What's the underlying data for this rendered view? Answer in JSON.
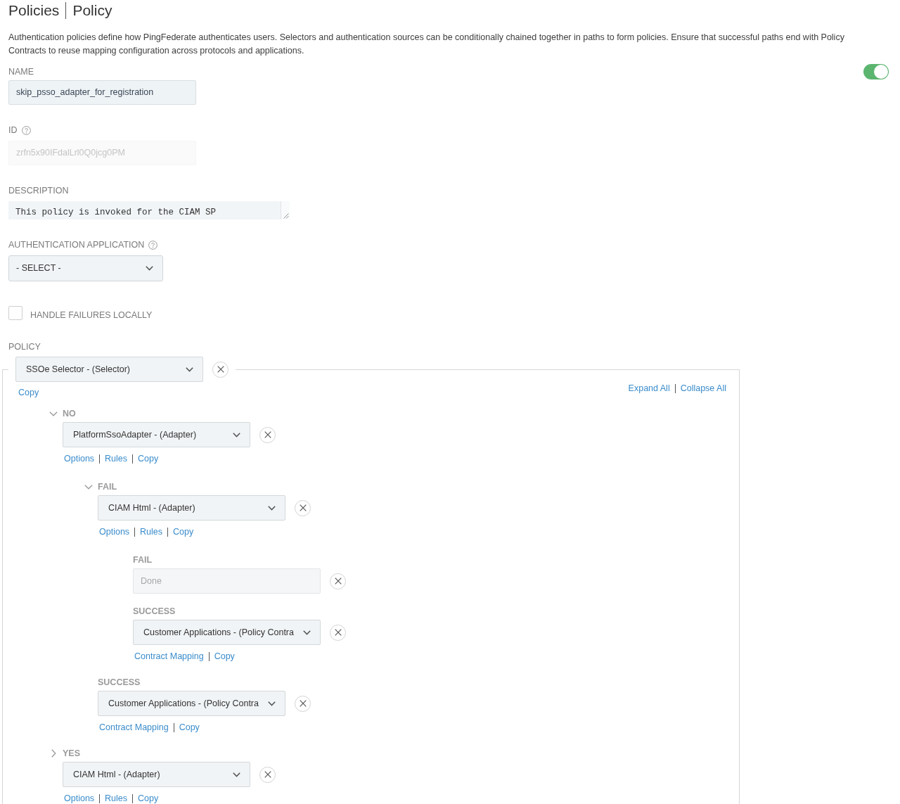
{
  "header": {
    "parent": "Policies",
    "current": "Policy"
  },
  "intro": "Authentication policies define how PingFederate authenticates users. Selectors and authentication sources can be conditionally chained together in paths to form policies. Ensure that successful paths end with Policy Contracts to reuse mapping configuration across protocols and applications.",
  "enabled_toggle": {
    "on": true
  },
  "fields": [
    {
      "kind": "text",
      "label": "NAME",
      "help": false,
      "value": "skip_psso_adapter_for_registration",
      "disabled": false
    },
    {
      "kind": "text",
      "label": "ID",
      "help": true,
      "value": "zrfn5x90IFdalLrl0Q0jcg0PM",
      "disabled": true
    },
    {
      "kind": "textarea",
      "label": "DESCRIPTION",
      "help": false,
      "value": "This policy is invoked for the CIAM SP",
      "disabled": false
    },
    {
      "kind": "select",
      "label": "AUTHENTICATION APPLICATION",
      "help": true,
      "value": "- SELECT -",
      "disabled": false
    },
    {
      "kind": "checkbox",
      "label": "HANDLE FAILURES LOCALLY",
      "help": false,
      "checked": false,
      "disabled": false
    }
  ],
  "policy": {
    "label": "POLICY",
    "actions": [
      "Expand All",
      "Collapse All"
    ],
    "root": {
      "kind": "select",
      "value": "SSOe Selector - (Selector)",
      "disabled": false,
      "links": [
        "Copy"
      ],
      "children": [
        {
          "label": "NO",
          "expanded": true,
          "kind": "select",
          "value": "PlatformSsoAdapter - (Adapter)",
          "disabled": false,
          "links": [
            "Options",
            "Rules",
            "Copy"
          ],
          "children": [
            {
              "label": "FAIL",
              "expanded": true,
              "kind": "select",
              "value": "CIAM Html - (Adapter)",
              "disabled": false,
              "links": [
                "Options",
                "Rules",
                "Copy"
              ],
              "children": [
                {
                  "label": "FAIL",
                  "kind": "input",
                  "value": "Done",
                  "disabled": true
                },
                {
                  "label": "SUCCESS",
                  "kind": "select",
                  "value": "Customer Applications - (Policy Contra",
                  "disabled": false,
                  "links": [
                    "Contract Mapping",
                    "Copy"
                  ]
                }
              ]
            },
            {
              "label": "SUCCESS",
              "kind": "select",
              "value": "Customer Applications - (Policy Contra",
              "disabled": false,
              "links": [
                "Contract Mapping",
                "Copy"
              ]
            }
          ]
        },
        {
          "label": "YES",
          "expanded": false,
          "kind": "select",
          "value": "CIAM Html - (Adapter)",
          "disabled": false,
          "links": [
            "Options",
            "Rules",
            "Copy"
          ]
        }
      ]
    }
  }
}
